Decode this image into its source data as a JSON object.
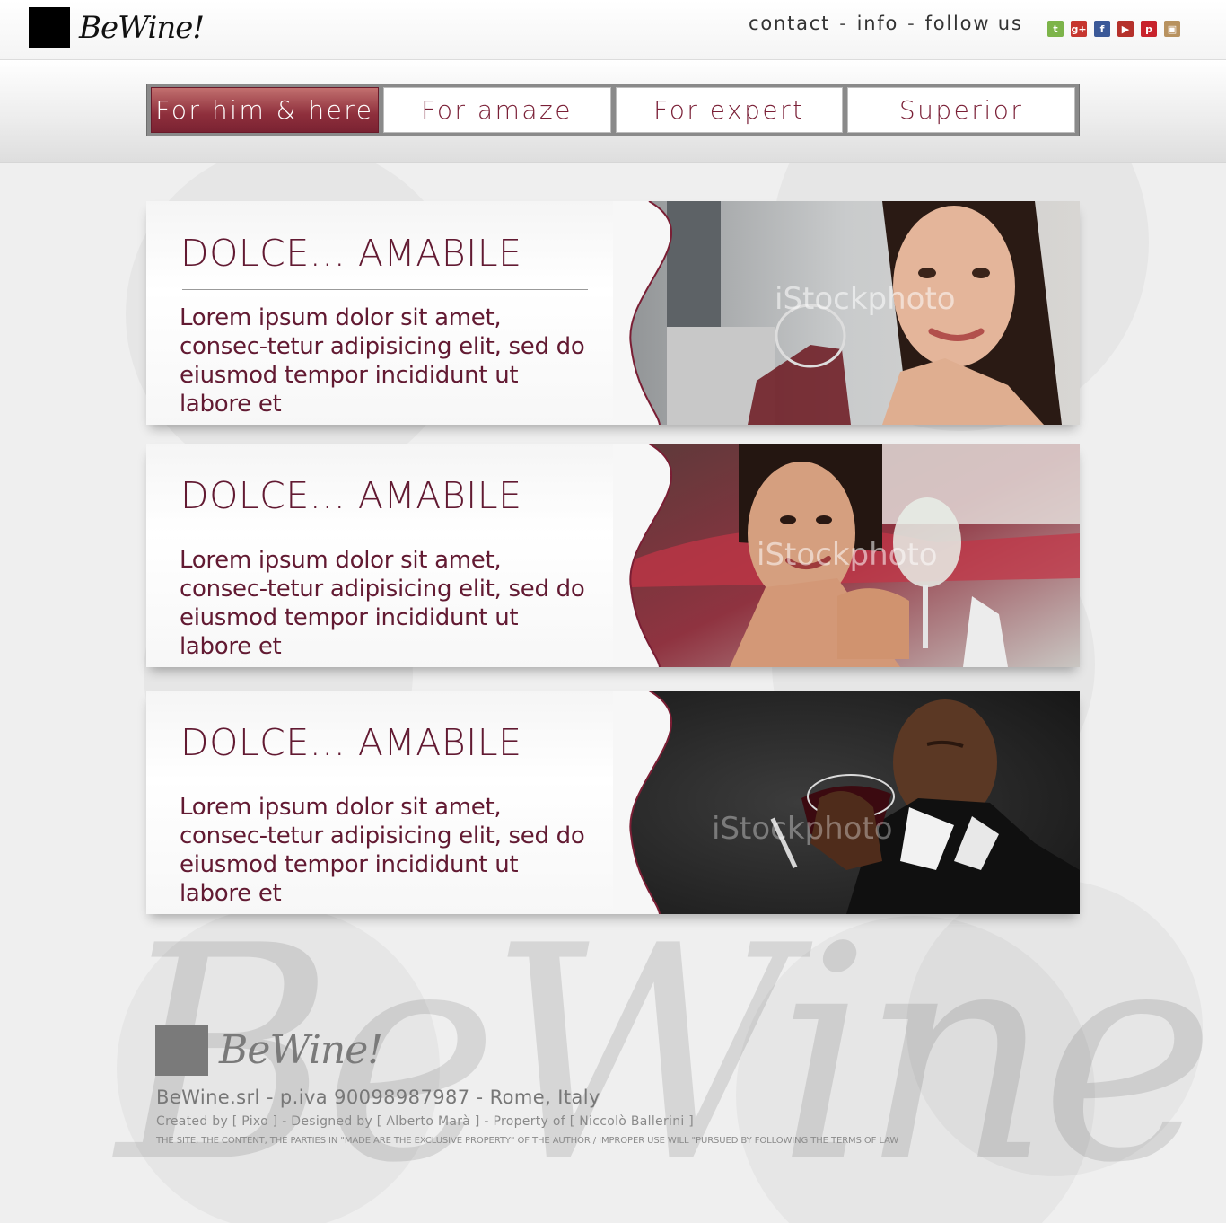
{
  "header": {
    "logo_text": "BeWine!",
    "links": [
      {
        "label": "contact"
      },
      {
        "label": "info"
      },
      {
        "label": "follow us"
      }
    ],
    "separator": "-",
    "social": [
      {
        "icon": "twitter-icon",
        "glyph": "t",
        "color": "#7db44a"
      },
      {
        "icon": "google-plus-icon",
        "glyph": "g+",
        "color": "#c6362f"
      },
      {
        "icon": "facebook-icon",
        "glyph": "f",
        "color": "#3b5998"
      },
      {
        "icon": "youtube-icon",
        "glyph": "▶",
        "color": "#b5312b"
      },
      {
        "icon": "pinterest-icon",
        "glyph": "p",
        "color": "#c8232c"
      },
      {
        "icon": "instagram-icon",
        "glyph": "▣",
        "color": "#b8925f"
      }
    ]
  },
  "nav": {
    "tabs": [
      {
        "label": "For him & here",
        "active": true
      },
      {
        "label": "For amaze",
        "active": false
      },
      {
        "label": "For expert",
        "active": false
      },
      {
        "label": "Superior",
        "active": false
      }
    ]
  },
  "cards": [
    {
      "title": "DOLCE... AMABILE",
      "text": "Lorem ipsum dolor sit amet, consec-tetur adipisicing elit, sed do eiusmod tempor incididunt ut labore et",
      "photo_watermark": "iStockphoto",
      "photo": "woman-red-wine"
    },
    {
      "title": "DOLCE... AMABILE",
      "text": "Lorem ipsum dolor sit amet, consec-tetur adipisicing elit, sed do eiusmod tempor incididunt ut labore et",
      "photo_watermark": "iStockphoto",
      "photo": "woman-white-wine"
    },
    {
      "title": "DOLCE... AMABILE",
      "text": "Lorem ipsum dolor sit amet, consec-tetur adipisicing elit, sed do eiusmod tempor incididunt ut labore et",
      "photo_watermark": "iStockphoto",
      "photo": "man-red-wine"
    }
  ],
  "footer": {
    "logo_text": "BeWine!",
    "company": "BeWine.srl - p.iva 90098987987 - Rome, Italy",
    "credits": "Created by [ Pixo ] - Designed by [ Alberto Marà ] - Property of  [ Niccolò Ballerini ]",
    "legal": "THE SITE, THE CONTENT, THE PARTIES IN \"MADE ARE THE EXCLUSIVE PROPERTY\" OF THE AUTHOR / IMPROPER USE WILL \"PURSUED BY FOLLOWING THE TERMS OF LAW"
  },
  "colors": {
    "accent": "#6a1a34",
    "active_tab": "#8e2f3c"
  }
}
